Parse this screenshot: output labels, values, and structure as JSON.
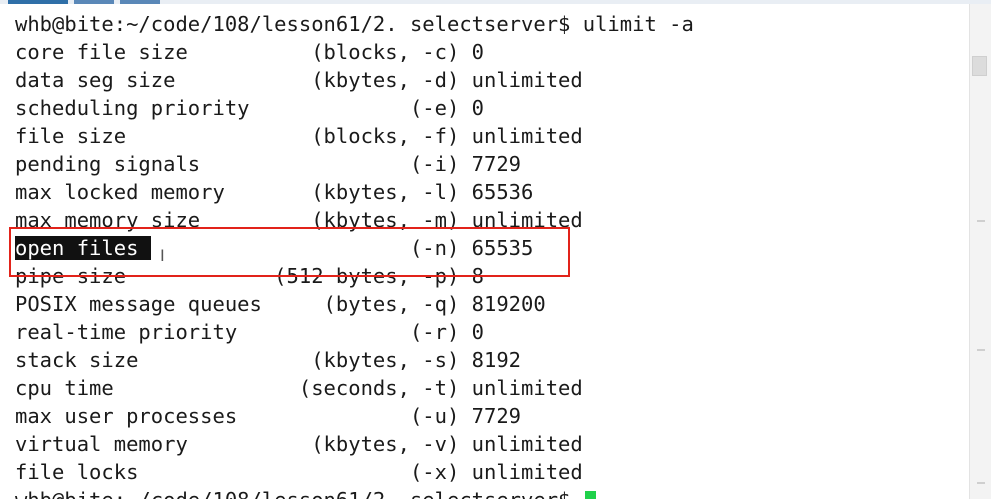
{
  "terminal": {
    "prompt": "whb@bite:~/code/108/lesson61/2. selectserver$ ulimit -a",
    "rows": [
      "core file size          (blocks, -c) 0",
      "data seg size           (kbytes, -d) unlimited",
      "scheduling priority             (-e) 0",
      "file size               (blocks, -f) unlimited",
      "pending signals                 (-i) 7729",
      "max locked memory       (kbytes, -l) 65536",
      "max memory size         (kbytes, -m) unlimited",
      "open files                      (-n) 65535",
      "pipe size            (512 bytes, -p) 8",
      "POSIX message queues     (bytes, -q) 819200",
      "real-time priority              (-r) 0",
      "stack size              (kbytes, -s) 8192",
      "cpu time               (seconds, -t) unlimited",
      "max user processes              (-u) 7729",
      "virtual memory          (kbytes, -v) unlimited",
      "file locks                      (-x) unlimited"
    ],
    "selected_text": "open files ",
    "selected_rest": "                     (-n) 65535",
    "final_prompt": "whb@bite:~/code/108/lesson61/2. selectserver$ "
  },
  "colors": {
    "annotation": "#e2231a",
    "cursor": "#1fd14a",
    "selection_bg": "#111111"
  },
  "icons": {
    "mouse_cursor": "i-beam-cursor-icon",
    "terminal_cursor": "block-cursor-icon"
  }
}
